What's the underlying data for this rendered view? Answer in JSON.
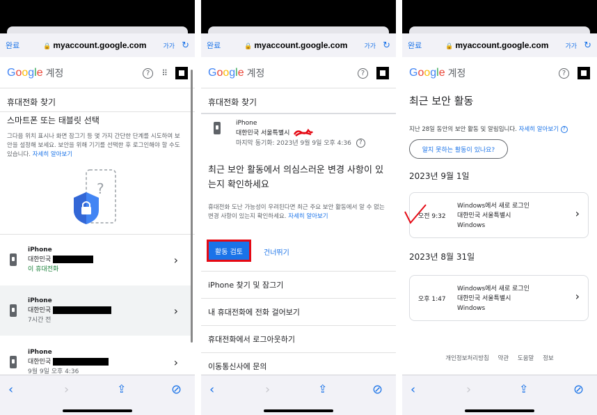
{
  "browser": {
    "done_label": "완료",
    "url": "myaccount.google.com",
    "text_size": "가가",
    "lock_glyph": "🔒",
    "reload_glyph": "↻"
  },
  "header": {
    "logo_letters": [
      "G",
      "o",
      "o",
      "g",
      "l",
      "e"
    ],
    "logo_colors": [
      "#4285F4",
      "#EA4335",
      "#FBBC05",
      "#4285F4",
      "#34A853",
      "#EA4335"
    ],
    "account": "계정",
    "help_glyph": "?",
    "apps_glyph": "⠿"
  },
  "nav": {
    "back": "‹",
    "forward": "›",
    "share": "⇪",
    "compass": "⊘"
  },
  "panel1": {
    "title": "휴대전화 찾기",
    "subtitle": "스마트폰 또는 태블릿 선택",
    "desc": "그다음 위치 표시나 화면 잠그기 등 몇 가지 간단한 단계를 시도하여 보안을 설정해 보세요. 보안을 위해 기기를 선택한 후 로그인해야 할 수도 있습니다.",
    "learn_more": "자세히 알아보기",
    "devices": [
      {
        "name": "iPhone",
        "region": "대한민국",
        "status": "이 휴대전화"
      },
      {
        "name": "iPhone",
        "region": "대한민국",
        "status": "7시간 전"
      },
      {
        "name": "iPhone",
        "region": "대한민국",
        "status": "9월 9일 오후 4:36"
      }
    ]
  },
  "panel2": {
    "title": "휴대전화 찾기",
    "device_name": "iPhone",
    "device_location": "대한민국 서울특별시",
    "last_sync": "마지막 동기화: 2023년 9월 9일 오후 4:36",
    "heading": "최근 보안 활동에서 의심스러운 변경 사항이 있는지 확인하세요",
    "desc": "휴대전화 도난 가능성이 우려된다면 최근 주요 보안 활동에서 알 수 없는 변경 사항이 있는지 확인하세요.",
    "learn_more": "자세히 알아보기",
    "review_button": "활동 검토",
    "skip_button": "건너뛰기",
    "menu": [
      "iPhone 찾기 및 잠그기",
      "내 휴대전화에 전화 걸어보기",
      "휴대전화에서 로그아웃하기",
      "이동통신사에 문의"
    ]
  },
  "panel3": {
    "title": "최근 보안 활동",
    "desc": "지난 28일 동안의 보안 활동 및 알림입니다.",
    "learn_more": "자세히 알아보기",
    "unknown_activity_button": "알지 못하는 활동이 있나요?",
    "groups": [
      {
        "date": "2023년 9월 1일",
        "time": "오전 9:32",
        "line1": "Windows에서 새로 로그인",
        "line2": "대한민국 서울특별시",
        "line3": "Windows"
      },
      {
        "date": "2023년 8월 31일",
        "time": "오후 1:47",
        "line1": "Windows에서 새로 로그인",
        "line2": "대한민국 서울특별시",
        "line3": "Windows"
      }
    ],
    "footer": [
      "개인정보처리방침",
      "약관",
      "도움말",
      "정보"
    ]
  }
}
